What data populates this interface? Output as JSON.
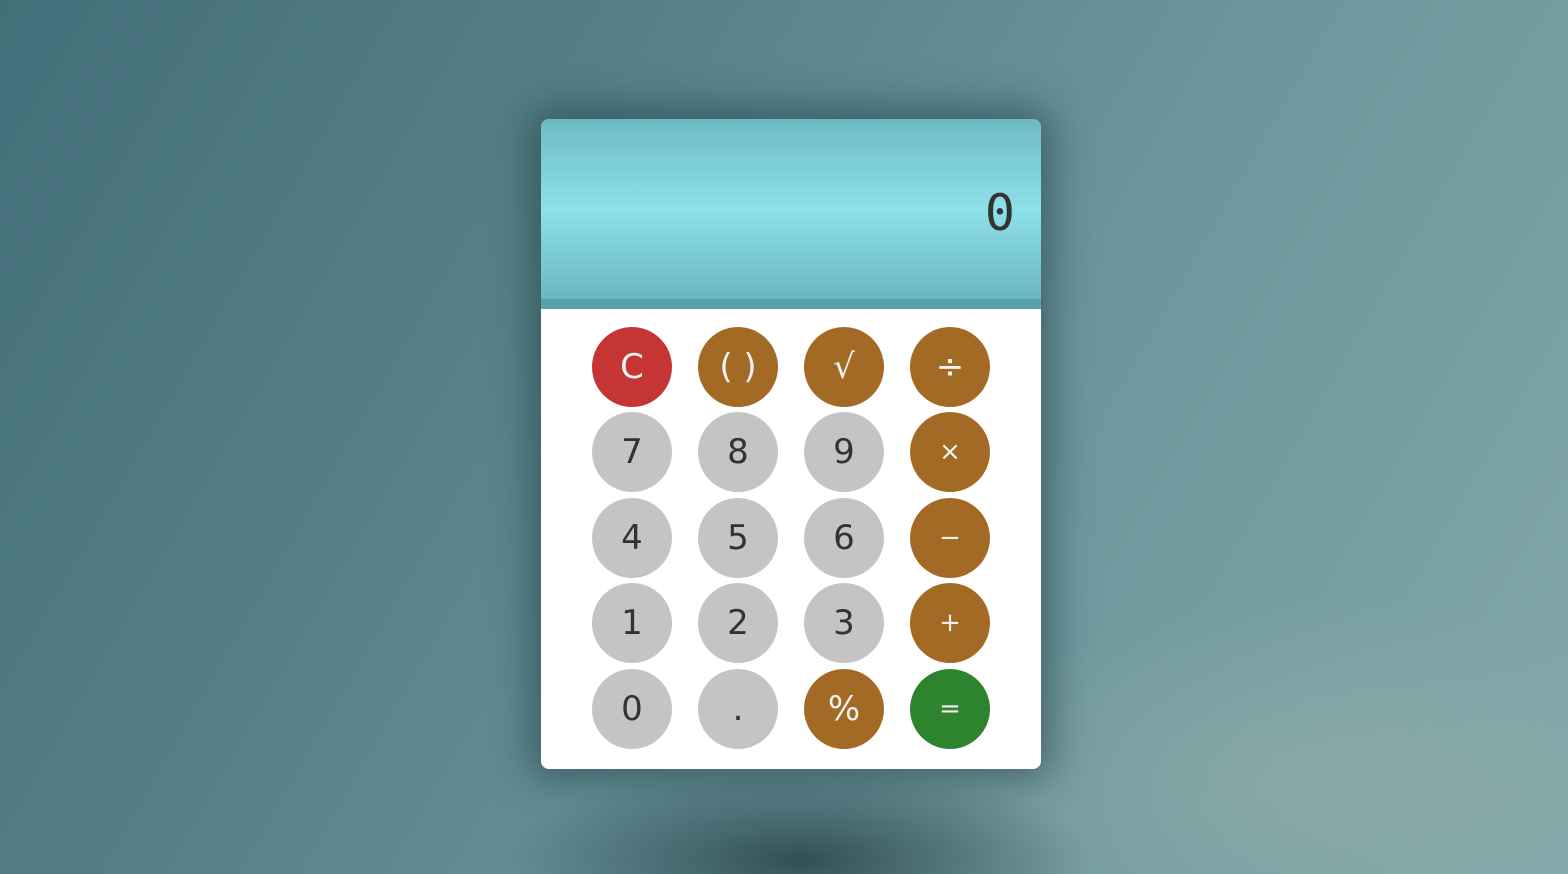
{
  "display": {
    "value": "0"
  },
  "keys": {
    "clear": "C",
    "parentheses": "( )",
    "sqrt": "√",
    "divide": "÷",
    "seven": "7",
    "eight": "8",
    "nine": "9",
    "multiply": "×",
    "four": "4",
    "five": "5",
    "six": "6",
    "subtract": "−",
    "one": "1",
    "two": "2",
    "three": "3",
    "add": "+",
    "zero": "0",
    "decimal": ".",
    "percent": "%",
    "equals": "="
  },
  "colors": {
    "background": "#557f86",
    "display": "#8ee0e9",
    "number_key": "#c4c4c4",
    "operator_key": "#a36a25",
    "clear_key": "#c53535",
    "equals_key": "#2e832e",
    "text_dark": "#333333",
    "text_light": "#f1f1f1"
  }
}
